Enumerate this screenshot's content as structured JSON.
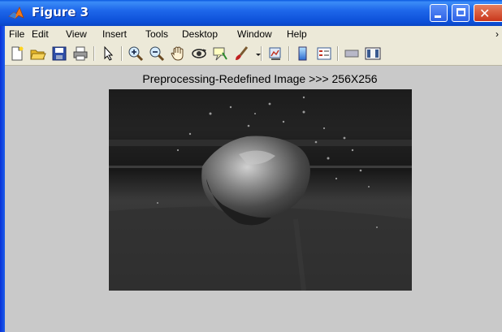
{
  "window": {
    "title": "Figure 3",
    "controls": {
      "minimize": "minimize",
      "maximize": "maximize",
      "close": "close"
    }
  },
  "menubar": {
    "items": [
      {
        "label": "File"
      },
      {
        "label": "Edit"
      },
      {
        "label": "View"
      },
      {
        "label": "Insert"
      },
      {
        "label": "Tools"
      },
      {
        "label": "Desktop"
      },
      {
        "label": "Window"
      },
      {
        "label": "Help"
      }
    ]
  },
  "toolbar": {
    "icons": [
      "new-figure-icon",
      "open-file-icon",
      "save-icon",
      "print-icon",
      "pointer-arrow-icon",
      "zoom-in-icon",
      "zoom-out-icon",
      "pan-hand-icon",
      "rotate-3d-icon",
      "data-cursor-icon",
      "brush-icon",
      "dropdown-arrow-icon",
      "link-plot-icon",
      "colorbar-icon",
      "legend-icon",
      "hide-plot-tools-icon",
      "show-plot-tools-icon"
    ]
  },
  "figure": {
    "plot_title": "Preprocessing-Redefined Image >>> 256X256",
    "image": "grayscale-object-on-dark-background"
  },
  "colors": {
    "title_bar": "#1e67ea",
    "menu_bg": "#ece9d8",
    "figure_bg": "#c9c9c9",
    "close_button": "#c9361b"
  }
}
